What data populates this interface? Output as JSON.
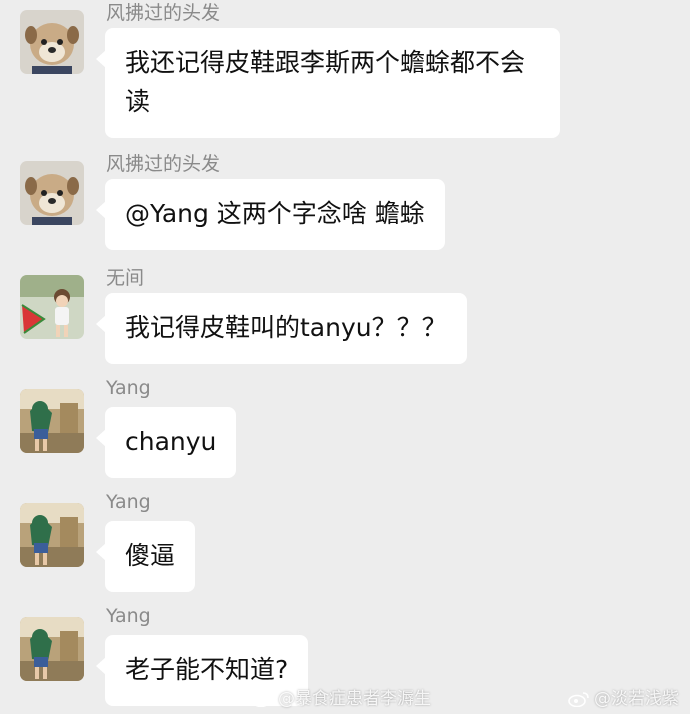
{
  "messages": [
    {
      "sender": "风拂过的头发",
      "text": "我还记得皮鞋跟李斯两个蟾蜍都不会读",
      "avatar": "dog-avatar"
    },
    {
      "sender": "风拂过的头发",
      "text": "@Yang 这两个字念啥 蟾蜍",
      "avatar": "dog-avatar"
    },
    {
      "sender": "无间",
      "text": "我记得皮鞋叫的tanyu？？？",
      "avatar": "child-watermelon-avatar"
    },
    {
      "sender": "Yang",
      "text": "chanyu",
      "avatar": "person-outdoor-avatar"
    },
    {
      "sender": "Yang",
      "text": "傻逼",
      "avatar": "person-outdoor-avatar"
    },
    {
      "sender": "Yang",
      "text": "老子能不知道?",
      "avatar": "person-outdoor-avatar"
    }
  ],
  "watermarks": {
    "left": "@暴食症患者李溽生",
    "right": "@淡若浅紫"
  },
  "colors": {
    "background": "#ededed",
    "bubble": "#ffffff",
    "sender_name": "#8a8a8a"
  }
}
